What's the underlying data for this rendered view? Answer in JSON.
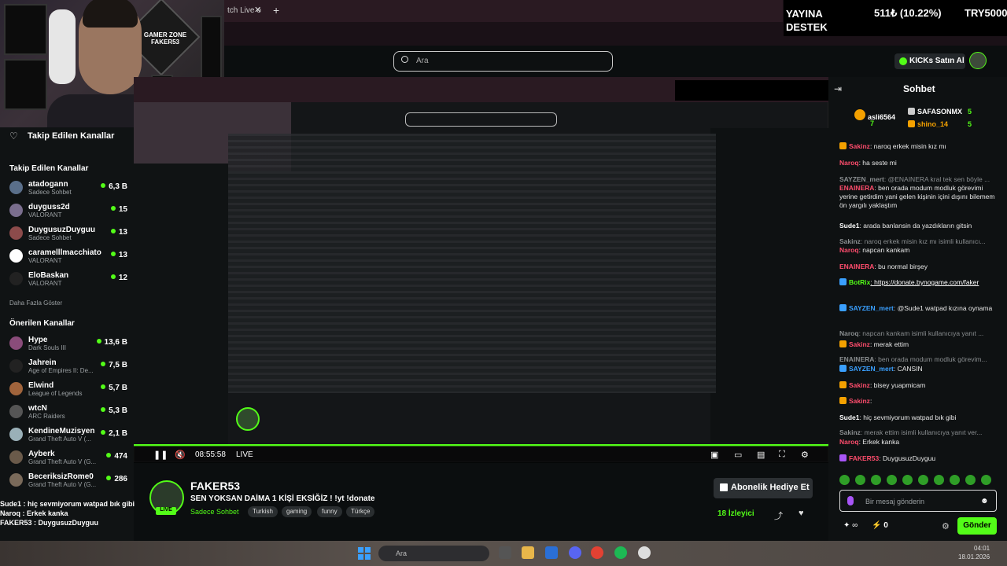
{
  "browser": {
    "tab_label": "tch Live o",
    "tab_close": "✕",
    "tab_add": "+"
  },
  "donation": {
    "title": "YAYINA DESTEK",
    "amount": "511₺ (10.22%)",
    "goal": "TRY5000"
  },
  "search": {
    "placeholder": "Ara"
  },
  "header": {
    "kicks_label": "KICKs Satın Al"
  },
  "webcam": {
    "poster_text": "GAMER ZONE FAKER53"
  },
  "sidebar": {
    "heading": "Takip Edilen Kanallar",
    "following_title": "Takip Edilen Kanallar",
    "following": [
      {
        "name": "atadogann",
        "sub": "Sadece Sohbet",
        "viewers": "6,3 B",
        "color": "#5a6f8a"
      },
      {
        "name": "duyguss2d",
        "sub": "VALORANT",
        "viewers": "15",
        "color": "#7a6e8e"
      },
      {
        "name": "DuygusuzDuyguu",
        "sub": "Sadece Sohbet",
        "viewers": "13",
        "color": "#8c4b4b"
      },
      {
        "name": "caramelllmacchiato",
        "sub": "VALORANT",
        "viewers": "13",
        "color": "#ffffff"
      },
      {
        "name": "EloBaskan",
        "sub": "VALORANT",
        "viewers": "12",
        "color": "#222222"
      }
    ],
    "more": "Daha Fazla Göster",
    "recommended_title": "Önerilen Kanallar",
    "recommended": [
      {
        "name": "Hype",
        "sub": "Dark Souls III",
        "viewers": "13,6 B",
        "color": "#8a4c7a"
      },
      {
        "name": "Jahrein",
        "sub": "Age of Empires II: De...",
        "viewers": "7,5 B",
        "color": "#222222"
      },
      {
        "name": "Elwind",
        "sub": "League of Legends",
        "viewers": "5,7 B",
        "color": "#a0643c"
      },
      {
        "name": "wtcN",
        "sub": "ARC Raiders",
        "viewers": "5,3 B",
        "color": "#555555"
      },
      {
        "name": "KendineMuzisyen",
        "sub": "Grand Theft Auto V (...",
        "viewers": "2,1 B",
        "color": "#9ab0b8"
      },
      {
        "name": "Ayberk",
        "sub": "Grand Theft Auto V (G...",
        "viewers": "474",
        "color": "#6a5a4a"
      },
      {
        "name": "BeceriksizRome0",
        "sub": "Grand Theft Auto V (G...",
        "viewers": "286",
        "color": "#7a6a5a"
      }
    ]
  },
  "overlay_chat": [
    {
      "user": "Sude1",
      "text": " : hiç sevmiyorum watpad bık gibi",
      "color": "#ffffff"
    },
    {
      "user": "Naroq",
      "text": " : Erkek kanka",
      "color": "#ffffff"
    },
    {
      "user": "FAKER53",
      "text": " : DuygusuzDuyguu",
      "color": "#ffffff"
    }
  ],
  "player": {
    "time": "08:55:58",
    "live": "LIVE"
  },
  "stream": {
    "name": "FAKER53",
    "live_badge": "LIVE",
    "title": "SEN YOKSAN DAİMA 1 KİŞİ EKSİĞİZ ! !yt !donate",
    "category": "Sadece Sohbet",
    "tags": [
      "Turkish",
      "gaming",
      "funny",
      "Türkçe"
    ],
    "subscribe_label": "Abonelik Hediye Et",
    "viewers": "18 İzleyici"
  },
  "chat": {
    "title": "Sohbet",
    "top_gifters": [
      {
        "name": "asli6564",
        "count": "7"
      },
      {
        "name": "SAFASONMX",
        "count": "5"
      },
      {
        "name": "shino_14",
        "count": "5"
      }
    ],
    "messages": [
      {
        "user": "Sakinz",
        "text": ": naroq erkek misin kız mı",
        "color": "#ff4d6d",
        "dim": false,
        "badge": "#f4a100"
      },
      {
        "user": "Naroq",
        "text": ": ha seste mi",
        "color": "#ff4d6d",
        "dim": false,
        "badge": ""
      },
      {
        "user": "SAYZEN_mert",
        "text": ": @ENAINERA kral tek sen böyle ...",
        "color": "#8a8e90",
        "dim": true,
        "badge": ""
      },
      {
        "user": "ENAINERA",
        "text": ": ben orada modum modluk görevimi yerine getirdim yani gelen kişinin içini dışını bilemem ön yargılı yaklaştım",
        "color": "#ff4d6d",
        "dim": false,
        "badge": ""
      },
      {
        "user": "Sude1",
        "text": ": arada banlansin da yazdıkların gitsin",
        "color": "#ffffff",
        "dim": false,
        "badge": ""
      },
      {
        "user": "Sakinz",
        "text": ": naroq erkek misin kız mı isimli kullanıcı...",
        "color": "#8a8e90",
        "dim": true,
        "badge": ""
      },
      {
        "user": "Naroq",
        "text": ": napcan kankam",
        "color": "#ff4d6d",
        "dim": false,
        "badge": ""
      },
      {
        "user": "ENAINERA",
        "text": ": bu normal birşey",
        "color": "#ff4d6d",
        "dim": false,
        "badge": ""
      },
      {
        "user": "BotRix",
        "text": ": https://donate.bynogame.com/faker",
        "color": "#53fc18",
        "dim": false,
        "badge": "#3aa0ff"
      },
      {
        "user": "SAYZEN_mert",
        "text": ": @Sude1 watpad kızına oynama",
        "color": "#3aa0ff",
        "dim": false,
        "badge": "#3aa0ff"
      },
      {
        "user": "Naroq",
        "text": ": napcan kankam isimli kullanıcıya yanıt ...",
        "color": "#8a8e90",
        "dim": true,
        "badge": ""
      },
      {
        "user": "Sakinz",
        "text": ": merak ettim",
        "color": "#ff4d6d",
        "dim": false,
        "badge": "#f4a100"
      },
      {
        "user": "ENAINERA",
        "text": ": ben orada modum modluk görevim...",
        "color": "#8a8e90",
        "dim": true,
        "badge": ""
      },
      {
        "user": "SAYZEN_mert",
        "text": ": CANSIN",
        "color": "#3aa0ff",
        "dim": false,
        "badge": "#3aa0ff"
      },
      {
        "user": "Sakinz",
        "text": ": bisey yuapmicam",
        "color": "#ff4d6d",
        "dim": false,
        "badge": "#f4a100"
      },
      {
        "user": "Sakinz",
        "text": ":",
        "color": "#ff4d6d",
        "dim": false,
        "badge": "#f4a100"
      },
      {
        "user": "Sude1",
        "text": ": hiç sevmiyorum watpad bık gibi",
        "color": "#ffffff",
        "dim": false,
        "badge": ""
      },
      {
        "user": "Sakinz",
        "text": ": merak ettim isimli kullanıcıya yanıt ver...",
        "color": "#8a8e90",
        "dim": true,
        "badge": ""
      },
      {
        "user": "Naroq",
        "text": ": Erkek kanka",
        "color": "#ff4d6d",
        "dim": false,
        "badge": ""
      },
      {
        "user": "FAKER53",
        "text": ": DuygusuzDuyguu",
        "color": "#ff4d6d",
        "dim": false,
        "badge": "#a855f7"
      }
    ],
    "input_placeholder": "Bir mesaj gönderin",
    "points": "∞",
    "bolts": "0",
    "send_label": "Gönder"
  },
  "taskbar": {
    "search_placeholder": "Ara",
    "time": "04:01",
    "date": "18.01.2026"
  }
}
